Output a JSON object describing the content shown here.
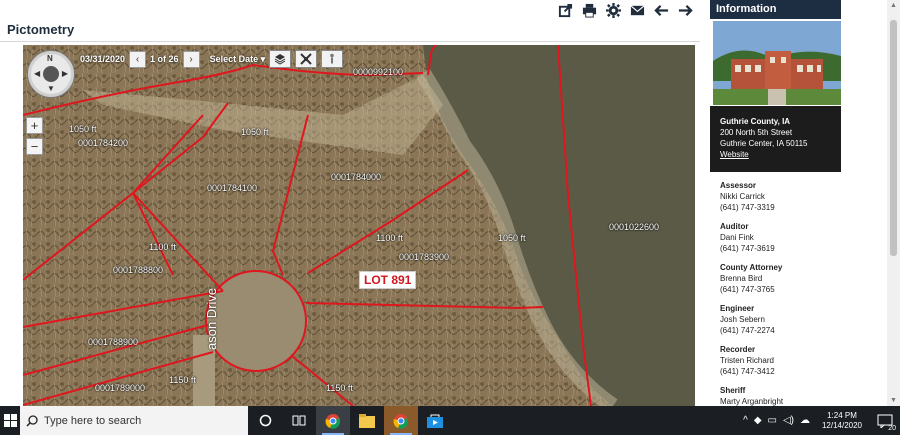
{
  "page": {
    "title": "Pictometry"
  },
  "toolbar": {
    "icons": [
      "share-icon",
      "print-icon",
      "gear-icon",
      "close-icon",
      "arrow-left-icon",
      "arrow-right-icon"
    ]
  },
  "map": {
    "date": "03/31/2020",
    "image_count": "1 of 26",
    "select_date_label": "Select Date",
    "parcels": [
      "0000992100",
      "0001784200",
      "0001784100",
      "0001784000",
      "0001783900",
      "0001788800",
      "0001788900",
      "0001789000",
      "0001022600"
    ],
    "measurements": [
      "1050 ft",
      "1050 ft",
      "1100 ft",
      "1100 ft",
      "1050 ft",
      "1150 ft",
      "1150 ft"
    ],
    "lot_label": "LOT 891",
    "street_label": "ason Drive",
    "zoom_in": "+",
    "zoom_out": "−",
    "compass_north": "N",
    "colors": {
      "parcel_line": "#e0161e",
      "water": "#5b5a46",
      "terrain": "#8d7a5a"
    }
  },
  "info": {
    "header": "Information",
    "address": {
      "county": "Guthrie County, IA",
      "street": "200 North 5th Street",
      "city": "Guthrie Center, IA 50115",
      "website_label": "Website"
    },
    "officials": [
      {
        "role": "Assessor",
        "name": "Nikki Carrick",
        "phone": "(641) 747-3319"
      },
      {
        "role": "Auditor",
        "name": "Dani Fink",
        "phone": "(641) 747-3619"
      },
      {
        "role": "County Attorney",
        "name": "Brenna Bird",
        "phone": "(641) 747-3765"
      },
      {
        "role": "Engineer",
        "name": "Josh Sebern",
        "phone": "(641) 747-2274"
      },
      {
        "role": "Recorder",
        "name": "Tristen Richard",
        "phone": "(641) 747-3412"
      },
      {
        "role": "Sheriff",
        "name": "Marty Arganbright",
        "phone": ""
      }
    ]
  },
  "taskbar": {
    "search_placeholder": "Type here to search",
    "time": "1:24 PM",
    "date": "12/14/2020",
    "notification_count": "20"
  }
}
